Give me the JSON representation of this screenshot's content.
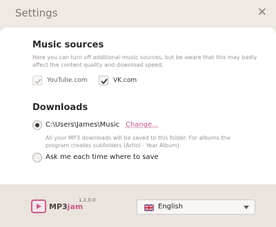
{
  "window": {
    "title": "Settings"
  },
  "music_sources": {
    "title": "Music sources",
    "description": "Here you can turn off additional music sources, but be aware that this may badly affect the content quality and download speed.",
    "sources": [
      {
        "label": "YouTube.com",
        "checked": true,
        "enabled": false
      },
      {
        "label": "VK.com",
        "checked": true,
        "enabled": true
      }
    ]
  },
  "downloads": {
    "title": "Downloads",
    "folder_path": "C:\\Users\\James\\Music",
    "change_link": "Change...",
    "folder_note": "All your MP3 downloads will be saved to this folder. For albums the program creates subfolders (Artist - Year Album)",
    "ask_label": "Ask me each time where to save",
    "selected": "folder"
  },
  "footer": {
    "logo_mp3": "MP3",
    "logo_jam": "jam",
    "version": "1.1.0.0",
    "language": "English",
    "language_icon": "uk-flag-icon"
  },
  "colors": {
    "accent": "#c85e8e",
    "link": "#c0568a",
    "background": "#ece6e1"
  }
}
